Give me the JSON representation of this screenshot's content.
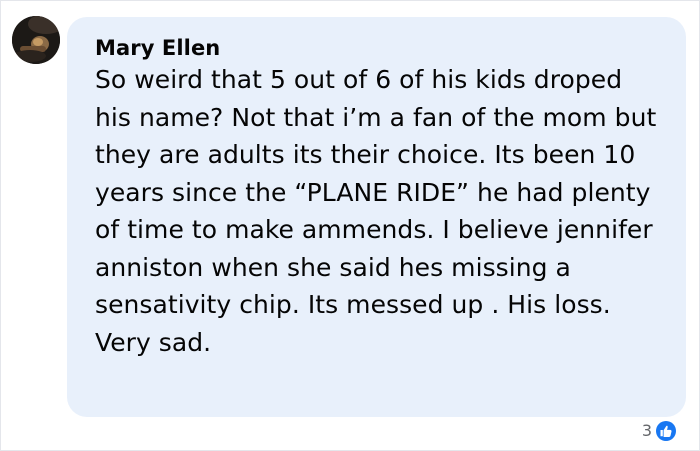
{
  "comment": {
    "author": "Mary Ellen",
    "text": "So weird that 5 out of 6 of his kids droped his name? Not that i’m a fan of the mom but they are adults its their choice. Its been 10 years since the “PLANE RIDE” he had plenty of time to make ammends. I believe jennifer anniston when she said hes missing a sensativity chip. Its messed up . His loss. Very sad.",
    "reaction_count": "3",
    "reaction_icon": "like-icon"
  },
  "colors": {
    "bubble": "#e8f0fb",
    "text": "#050505",
    "muted": "#65676b",
    "like_blue": "#1877f2"
  }
}
